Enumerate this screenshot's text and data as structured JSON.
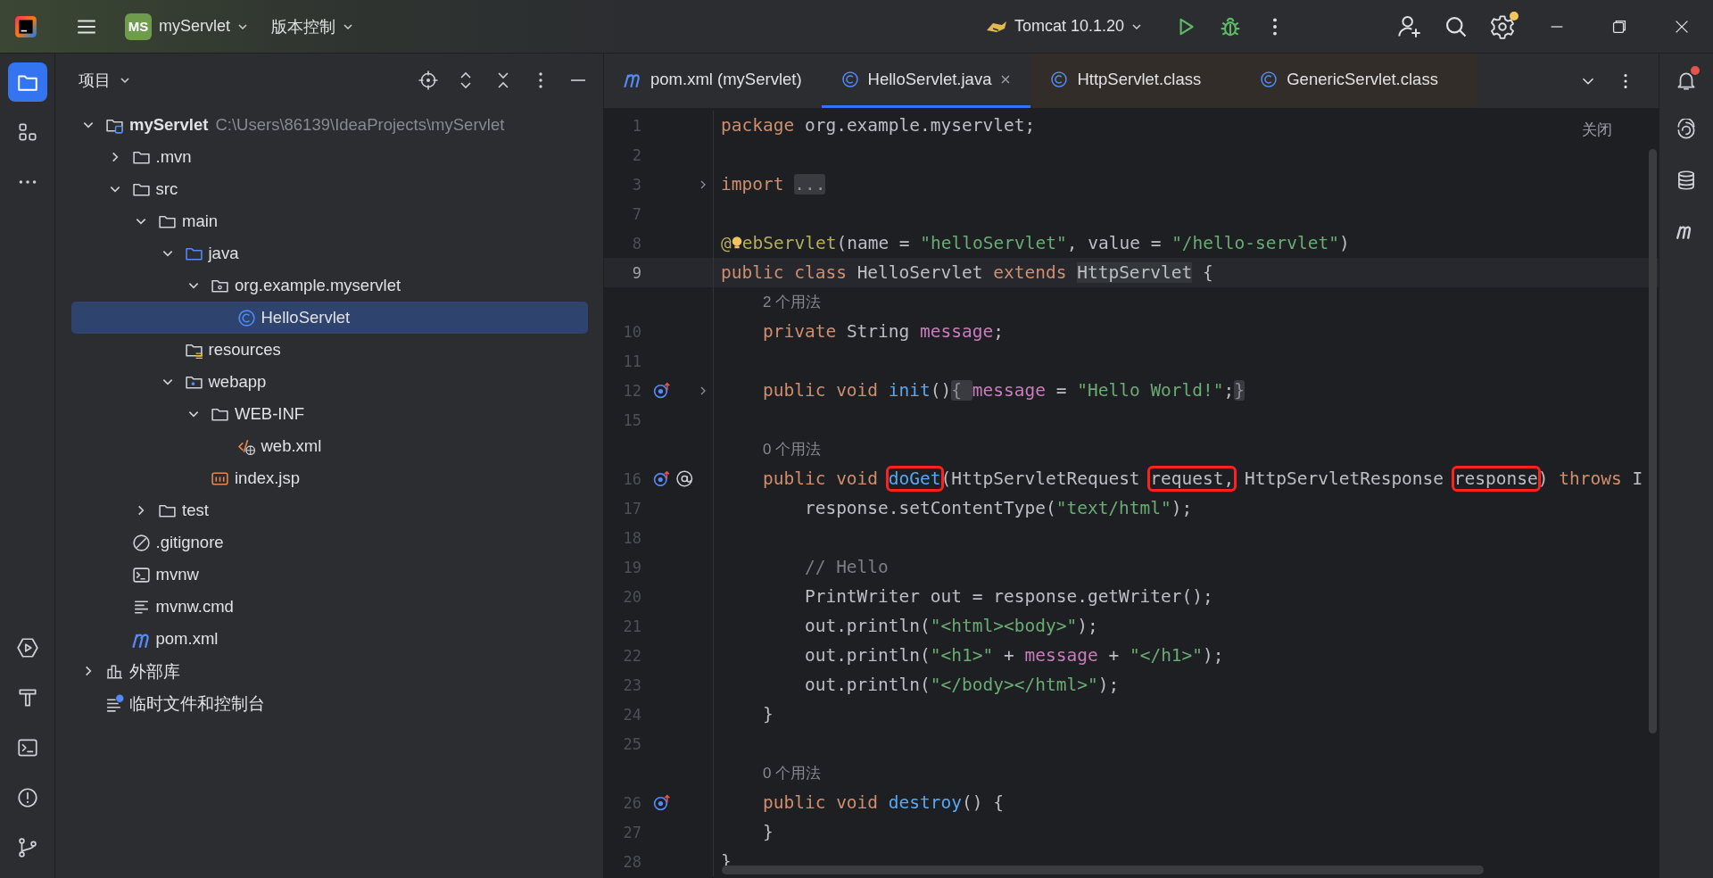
{
  "topbar": {
    "project": {
      "badge": "MS",
      "name": "myServlet"
    },
    "vcs": "版本控制",
    "run_config": "Tomcat 10.1.20",
    "settings_update": true
  },
  "left_tools": [
    {
      "kind": "project",
      "selected": true
    },
    {
      "kind": "structure",
      "selected": false
    },
    {
      "kind": "more",
      "selected": false
    },
    {
      "kind": "services",
      "selected": false
    },
    {
      "kind": "build",
      "selected": false
    },
    {
      "kind": "terminal",
      "selected": false
    },
    {
      "kind": "problems",
      "selected": false
    },
    {
      "kind": "git",
      "selected": false
    }
  ],
  "project_panel": {
    "title": "项目",
    "tree": [
      {
        "label": "myServlet",
        "path": "C:\\Users\\86139\\IdeaProjects\\myServlet",
        "kind": "module",
        "expanded": true,
        "selected": false,
        "children": [
          {
            "label": ".mvn",
            "kind": "folder",
            "expanded": false,
            "selected": false
          },
          {
            "label": "src",
            "kind": "folder",
            "expanded": true,
            "selected": false,
            "children": [
              {
                "label": "main",
                "kind": "folder",
                "expanded": true,
                "selected": false,
                "children": [
                  {
                    "label": "java",
                    "kind": "source",
                    "expanded": true,
                    "selected": false,
                    "children": [
                      {
                        "label": "org.example.myservlet",
                        "kind": "package",
                        "expanded": true,
                        "selected": false,
                        "children": [
                          {
                            "label": "HelloServlet",
                            "kind": "class",
                            "selected": true
                          }
                        ]
                      }
                    ]
                  },
                  {
                    "label": "resources",
                    "kind": "resources",
                    "selected": false
                  },
                  {
                    "label": "webapp",
                    "kind": "web",
                    "expanded": true,
                    "selected": false,
                    "children": [
                      {
                        "label": "WEB-INF",
                        "kind": "folder",
                        "expanded": true,
                        "selected": false,
                        "children": [
                          {
                            "label": "web.xml",
                            "kind": "xml",
                            "selected": false
                          }
                        ]
                      },
                      {
                        "label": "index.jsp",
                        "kind": "jsp",
                        "selected": false
                      }
                    ]
                  }
                ]
              },
              {
                "label": "test",
                "kind": "folder",
                "expanded": false,
                "selected": false
              }
            ]
          },
          {
            "label": ".gitignore",
            "kind": "gitignore",
            "selected": false
          },
          {
            "label": "mvnw",
            "kind": "script",
            "selected": false
          },
          {
            "label": "mvnw.cmd",
            "kind": "text",
            "selected": false
          },
          {
            "label": "pom.xml",
            "kind": "maven",
            "selected": false
          }
        ]
      },
      {
        "label": "外部库",
        "kind": "library",
        "expanded": false,
        "selected": false
      },
      {
        "label": "临时文件和控制台",
        "kind": "scratch",
        "selected": false
      }
    ]
  },
  "editor": {
    "tabs": [
      {
        "label": "pom.xml (myServlet)",
        "kind": "maven",
        "selected": false
      },
      {
        "label": "HelloServlet.java",
        "kind": "class",
        "selected": true
      },
      {
        "label": "HttpServlet.class",
        "kind": "class-file",
        "selected": false
      },
      {
        "label": "GenericServlet.class",
        "kind": "class-file",
        "selected": false
      }
    ],
    "close_hint": "关闭",
    "lines": [
      {
        "kind": "code",
        "number": "1",
        "current": false,
        "tokens": [
          {
            "kind": "kw",
            "text": "package "
          },
          {
            "kind": "plain",
            "text": "org.example.myservlet;"
          }
        ]
      },
      {
        "kind": "code",
        "number": "2",
        "current": false
      },
      {
        "kind": "code",
        "number": "3",
        "current": false,
        "foldable": true,
        "tokens": [
          {
            "kind": "kw",
            "text": "import "
          },
          {
            "kind": "fold",
            "text": "..."
          }
        ]
      },
      {
        "kind": "code",
        "number": "7",
        "current": false
      },
      {
        "kind": "code",
        "number": "8",
        "current": false,
        "tokens": [
          {
            "kind": "annot",
            "text": "@"
          },
          {
            "kind": "bulb"
          },
          {
            "kind": "annot",
            "text": "ebServlet"
          },
          {
            "kind": "plain",
            "text": "(name = "
          },
          {
            "kind": "str",
            "text": "\"helloServlet\""
          },
          {
            "kind": "plain",
            "text": ", value = "
          },
          {
            "kind": "str",
            "text": "\"/hello-servlet\""
          },
          {
            "kind": "plain",
            "text": ")"
          }
        ]
      },
      {
        "kind": "code",
        "number": "9",
        "current": true,
        "tokens": [
          {
            "kind": "kw",
            "text": "public class "
          },
          {
            "kind": "plain",
            "text": "HelloServlet "
          },
          {
            "kind": "kw",
            "text": "extends "
          },
          {
            "kind": "ref",
            "text": "HttpServlet"
          },
          {
            "kind": "plain",
            "text": " {"
          }
        ],
        "children": [
          {
            "kind": "usage",
            "current": false,
            "text": "2 个用法"
          },
          {
            "kind": "code",
            "number": "10",
            "current": false,
            "tokens": [
              {
                "kind": "kw",
                "text": "private "
              },
              {
                "kind": "plain",
                "text": "String "
              },
              {
                "kind": "field",
                "text": "message"
              },
              {
                "kind": "plain",
                "text": ";"
              }
            ]
          },
          {
            "kind": "code",
            "number": "11",
            "current": false
          },
          {
            "kind": "code",
            "number": "12",
            "current": false,
            "foldable": true,
            "gutter": [
              {
                "kind": "override"
              }
            ],
            "tokens": [
              {
                "kind": "kw",
                "text": "public void "
              },
              {
                "kind": "fn",
                "text": "init"
              },
              {
                "kind": "plain",
                "text": "()"
              },
              {
                "kind": "fold",
                "text": "{ "
              },
              {
                "kind": "field",
                "text": "message"
              },
              {
                "kind": "plain",
                "text": " = "
              },
              {
                "kind": "str",
                "text": "\"Hello World!\""
              },
              {
                "kind": "plain",
                "text": ";"
              },
              {
                "kind": "fold",
                "text": "}"
              }
            ]
          },
          {
            "kind": "code",
            "number": "15",
            "current": false
          },
          {
            "kind": "usage",
            "current": false,
            "text": "0 个用法"
          },
          {
            "kind": "code",
            "number": "16",
            "current": false,
            "gutter": [
              {
                "kind": "override"
              },
              {
                "kind": "at"
              }
            ],
            "tokens": [
              {
                "kind": "kw",
                "text": "public void ",
                "boxed": false
              },
              {
                "kind": "fn",
                "text": "doGet",
                "boxed": true
              },
              {
                "kind": "plain",
                "text": "(HttpServletRequest ",
                "boxed": false
              },
              {
                "kind": "plain",
                "text": "request,",
                "boxed": true
              },
              {
                "kind": "plain",
                "text": " HttpServletResponse ",
                "boxed": false
              },
              {
                "kind": "plain",
                "text": "response",
                "boxed": true
              },
              {
                "kind": "plain",
                "text": ") ",
                "boxed": false
              },
              {
                "kind": "kw",
                "text": "throws ",
                "boxed": false
              },
              {
                "kind": "plain",
                "text": "I",
                "boxed": false
              }
            ],
            "children": [
              {
                "kind": "code",
                "number": "17",
                "current": false,
                "tokens": [
                  {
                    "kind": "plain",
                    "text": "response.setContentType("
                  },
                  {
                    "kind": "str",
                    "text": "\"text/html\""
                  },
                  {
                    "kind": "plain",
                    "text": ");"
                  }
                ]
              },
              {
                "kind": "code",
                "number": "18",
                "current": false
              },
              {
                "kind": "code",
                "number": "19",
                "current": false,
                "tokens": [
                  {
                    "kind": "comment",
                    "text": "// Hello"
                  }
                ]
              },
              {
                "kind": "code",
                "number": "20",
                "current": false,
                "tokens": [
                  {
                    "kind": "plain",
                    "text": "PrintWriter out = response.getWriter();"
                  }
                ]
              },
              {
                "kind": "code",
                "number": "21",
                "current": false,
                "tokens": [
                  {
                    "kind": "plain",
                    "text": "out.println("
                  },
                  {
                    "kind": "str",
                    "text": "\"<html><body>\""
                  },
                  {
                    "kind": "plain",
                    "text": ");"
                  }
                ]
              },
              {
                "kind": "code",
                "number": "22",
                "current": false,
                "tokens": [
                  {
                    "kind": "plain",
                    "text": "out.println("
                  },
                  {
                    "kind": "str",
                    "text": "\"<h1>\""
                  },
                  {
                    "kind": "plain",
                    "text": " + "
                  },
                  {
                    "kind": "field",
                    "text": "message"
                  },
                  {
                    "kind": "plain",
                    "text": " + "
                  },
                  {
                    "kind": "str",
                    "text": "\"</h1>\""
                  },
                  {
                    "kind": "plain",
                    "text": ");"
                  }
                ]
              },
              {
                "kind": "code",
                "number": "23",
                "current": false,
                "tokens": [
                  {
                    "kind": "plain",
                    "text": "out.println("
                  },
                  {
                    "kind": "str",
                    "text": "\"</body></html>\""
                  },
                  {
                    "kind": "plain",
                    "text": ");"
                  }
                ]
              }
            ]
          },
          {
            "kind": "code",
            "number": "24",
            "current": false,
            "tokens": [
              {
                "kind": "plain",
                "text": "}"
              }
            ]
          },
          {
            "kind": "code",
            "number": "25",
            "current": false
          },
          {
            "kind": "usage",
            "current": false,
            "text": "0 个用法"
          },
          {
            "kind": "code",
            "number": "26",
            "current": false,
            "gutter": [
              {
                "kind": "override"
              }
            ],
            "tokens": [
              {
                "kind": "kw",
                "text": "public void "
              },
              {
                "kind": "fn",
                "text": "destroy"
              },
              {
                "kind": "plain",
                "text": "() {"
              }
            ]
          },
          {
            "kind": "code",
            "number": "27",
            "current": false,
            "tokens": [
              {
                "kind": "plain",
                "text": "}"
              }
            ]
          }
        ]
      },
      {
        "kind": "code",
        "number": "28",
        "current": false,
        "tokens": [
          {
            "kind": "plain",
            "text": "}"
          }
        ]
      }
    ]
  },
  "right_tools": [
    {
      "kind": "notifications",
      "selected": false,
      "unread": true
    },
    {
      "kind": "ai",
      "selected": false
    },
    {
      "kind": "database",
      "selected": false
    },
    {
      "kind": "maven",
      "selected": false
    }
  ]
}
